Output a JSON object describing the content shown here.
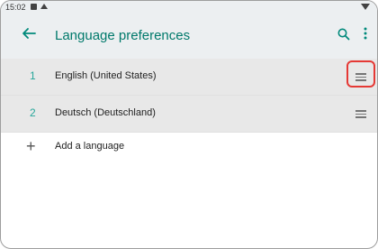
{
  "status_bar": {
    "time": "15:02"
  },
  "app_bar": {
    "title": "Language preferences"
  },
  "languages": [
    {
      "number": "1",
      "name": "English (United States)"
    },
    {
      "number": "2",
      "name": "Deutsch (Deutschland)"
    }
  ],
  "add_language": {
    "label": "Add a language"
  },
  "colors": {
    "accent": "#00796b",
    "number": "#26a69a",
    "highlight": "#e53935",
    "row_bg": "#e8e8e8"
  }
}
